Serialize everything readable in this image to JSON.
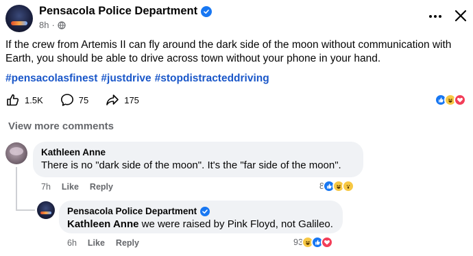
{
  "post": {
    "author": "Pensacola Police Department",
    "time": "8h",
    "text": "If the crew from Artemis II can fly around the dark side of the moon without communication with Earth, you should be able to drive across town without your phone in your hand.",
    "hashtags": [
      "#pensacolasfinest",
      "#justdrive",
      "#stopdistracteddriving"
    ],
    "likes": "1.5K",
    "comments": "75",
    "shares": "175",
    "reaction_icons": [
      "like",
      "haha",
      "love"
    ]
  },
  "view_more_comments": "View more comments",
  "comments": [
    {
      "author": "Kathleen Anne",
      "text": "There is no \"dark side of the moon\". It's the \"far side of the moon\".",
      "time": "7h",
      "like_label": "Like",
      "reply_label": "Reply",
      "reaction_count": "8",
      "reaction_icons": [
        "like",
        "haha",
        "wow"
      ]
    }
  ],
  "reply": {
    "author": "Pensacola Police Department",
    "mention": "Kathleen Anne",
    "text": " we were raised by Pink Floyd, not Galileo.",
    "time": "6h",
    "like_label": "Like",
    "reply_label": "Reply",
    "reaction_count": "93",
    "reaction_icons": [
      "haha",
      "like",
      "love"
    ]
  },
  "colors": {
    "accent": "#1877f2",
    "hashtag": "#1a57c9",
    "muted": "#65676b",
    "bubble": "#f0f2f5"
  }
}
